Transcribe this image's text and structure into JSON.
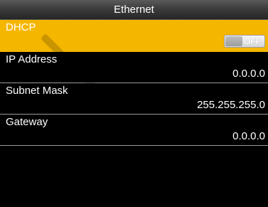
{
  "header": {
    "title": "Ethernet"
  },
  "settings": [
    {
      "label": "DHCP",
      "type": "toggle",
      "toggle_text": "OFF",
      "selected": true
    },
    {
      "label": "IP Address",
      "type": "value",
      "value": "0.0.0.0"
    },
    {
      "label": "Subnet Mask",
      "type": "value",
      "value": "255.255.255.0"
    },
    {
      "label": "Gateway",
      "type": "value",
      "value": "0.0.0.0"
    }
  ],
  "colors": {
    "selected_row": "#f5b600",
    "background": "#000000"
  }
}
